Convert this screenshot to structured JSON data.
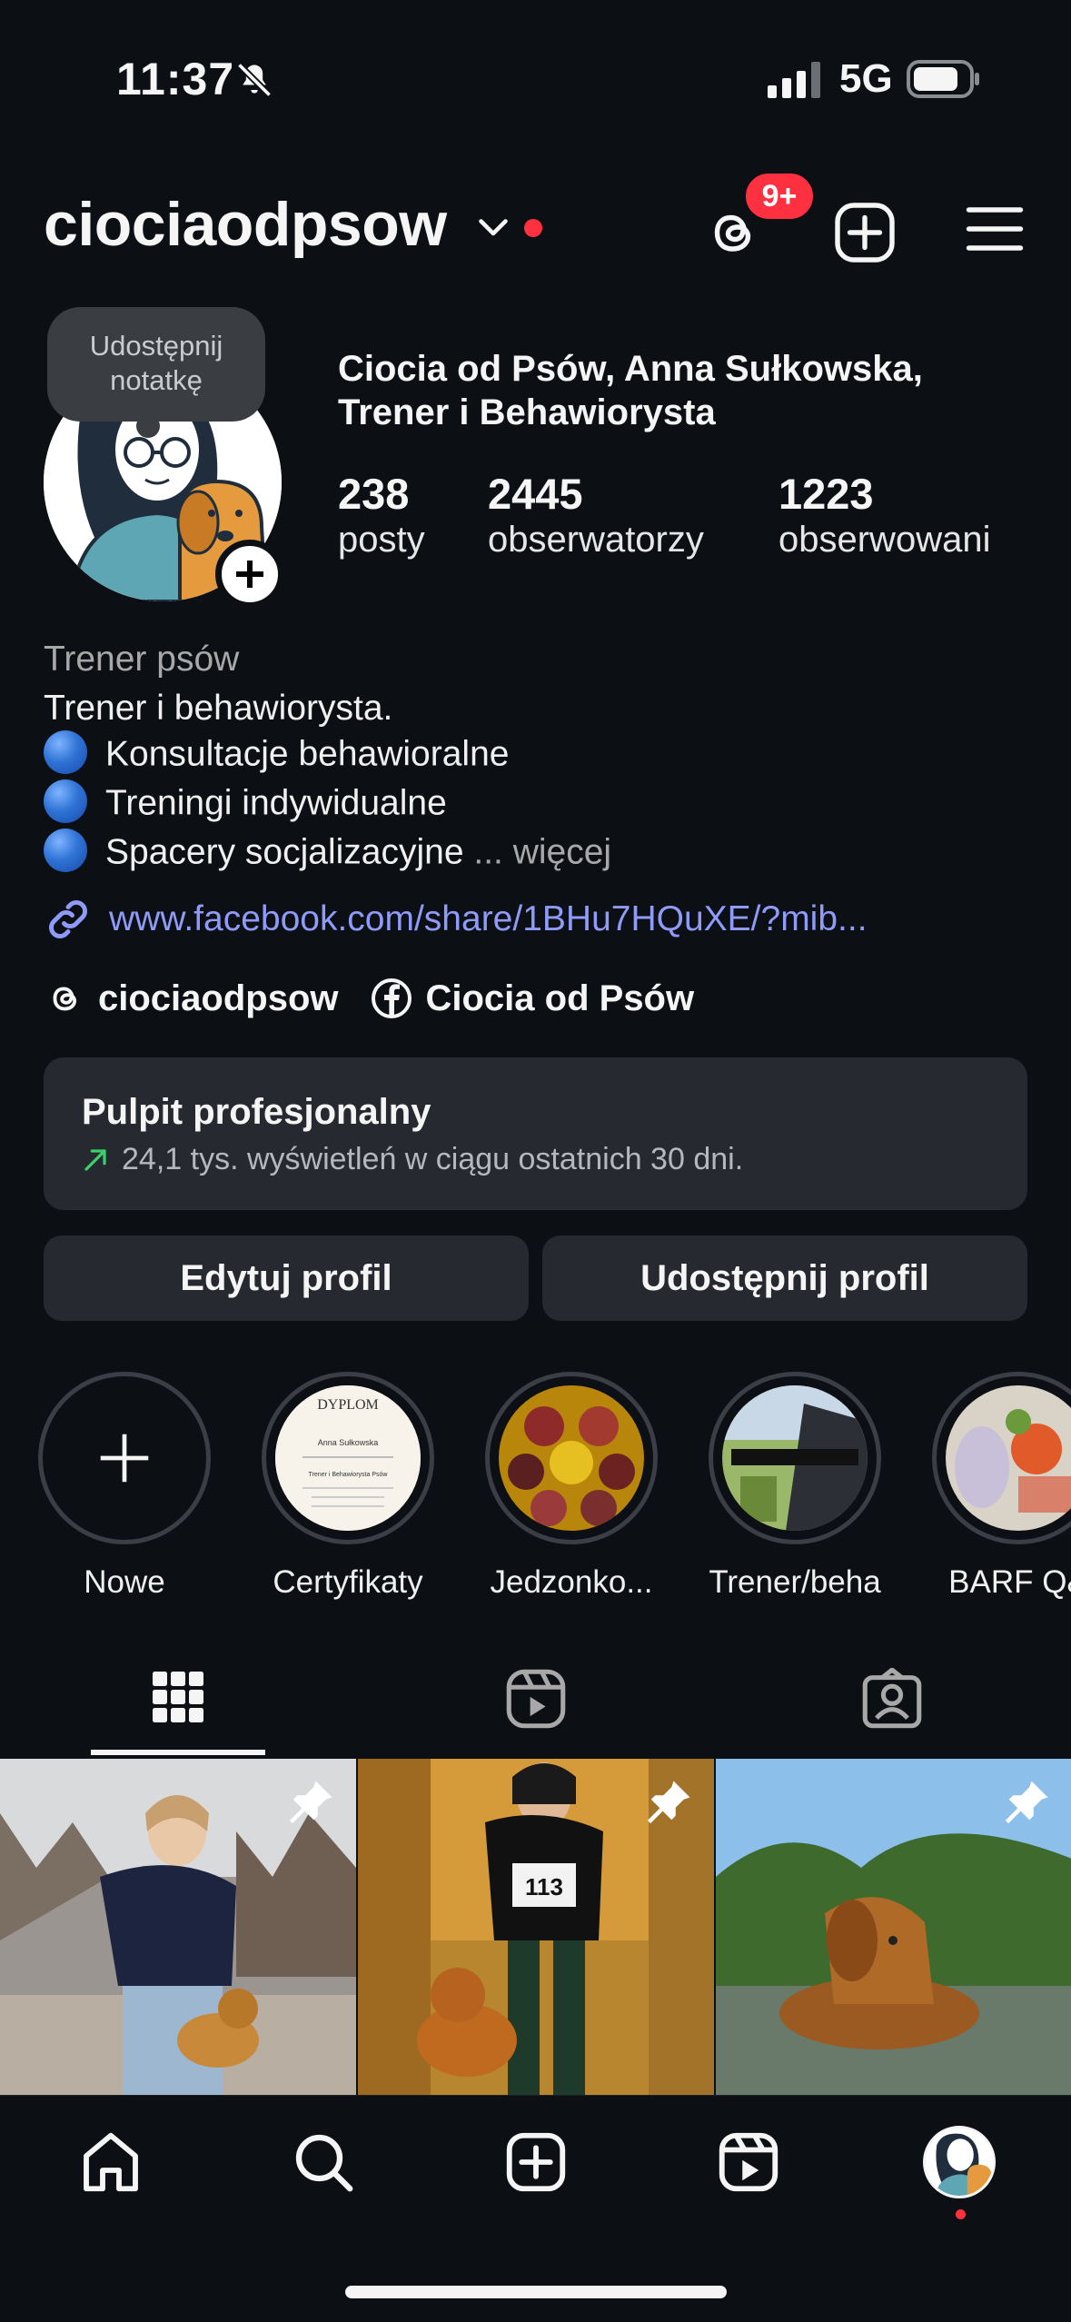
{
  "status_bar": {
    "time": "11:37",
    "network": "5G"
  },
  "header": {
    "username": "ciociaodpsow",
    "threads_badge": "9+"
  },
  "profile": {
    "note": "Udostępnij notatkę",
    "display_name": "Ciocia od Psów, Anna Sułkowska, Trener i Behawiorysta",
    "stats": [
      {
        "value": "238",
        "label": "posty"
      },
      {
        "value": "2445",
        "label": "obserwatorzy"
      },
      {
        "value": "1223",
        "label": "obserwowani"
      }
    ],
    "category": "Trener psów",
    "bio_lines": [
      "Trener i behawiorysta.",
      "Konsultacje behawioralne",
      "Treningi indywidualne",
      "Spacery socjalizacyjne"
    ],
    "bio_ellipsis": "...",
    "more_label": "więcej",
    "link": "www.facebook.com/share/1BHu7HQuXE/?mib...",
    "threads_handle": "ciociaodpsow",
    "facebook_name": "Ciocia od Psów"
  },
  "dashboard": {
    "title": "Pulpit profesjonalny",
    "subtitle": "24,1 tys. wyświetleń w ciągu ostatnich 30 dni."
  },
  "buttons": {
    "edit": "Edytuj profil",
    "share": "Udostępnij profil"
  },
  "highlights": [
    {
      "label": "Nowe"
    },
    {
      "label": "Certyfikaty",
      "cert_title": "DYPLOM",
      "cert_name": "Anna Sułkowska",
      "cert_role": "Trener i Behawiorysta Psów"
    },
    {
      "label": "Jedzonko..."
    },
    {
      "label": "Trener/beha"
    },
    {
      "label": "BARF Q&"
    }
  ],
  "posts": [
    {
      "pinned": true,
      "bib": ""
    },
    {
      "pinned": true,
      "bib": "113"
    },
    {
      "pinned": true,
      "bib": ""
    }
  ],
  "colors": {
    "background": "#0c0f14",
    "card": "#262a30",
    "link": "#8f9bf8",
    "notification": "#ff3040"
  },
  "icons": {
    "tabs": [
      "grid-icon",
      "reels-icon",
      "tagged-icon"
    ],
    "nav": [
      "home-icon",
      "search-icon",
      "create-icon",
      "reels-icon",
      "profile-avatar"
    ]
  }
}
